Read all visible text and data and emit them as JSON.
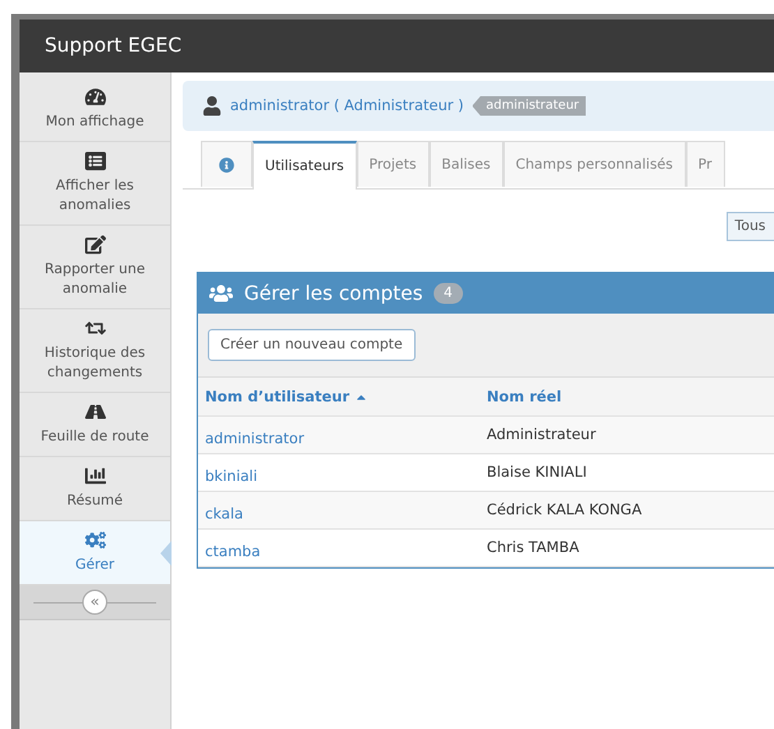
{
  "window": {
    "title": "Support EGEC"
  },
  "sidebar": {
    "items": [
      {
        "label": "Mon affichage",
        "selected": false
      },
      {
        "label": "Afficher les anomalies",
        "selected": false
      },
      {
        "label": "Rapporter une anomalie",
        "selected": false
      },
      {
        "label": "Historique des changements",
        "selected": false
      },
      {
        "label": "Feuille de route",
        "selected": false
      },
      {
        "label": "Résumé",
        "selected": false
      },
      {
        "label": "Gérer",
        "selected": true
      }
    ],
    "collapse_button": "«"
  },
  "breadcrumb": {
    "user": "administrator ( Administrateur )",
    "role": "administrateur"
  },
  "tabs": [
    {
      "kind": "icon",
      "selected": false
    },
    {
      "kind": "text",
      "label": "Utilisateurs",
      "selected": true
    },
    {
      "kind": "text",
      "label": "Projets",
      "selected": false
    },
    {
      "kind": "text",
      "label": "Balises",
      "selected": false
    },
    {
      "kind": "text",
      "label": "Champs personnalisés",
      "selected": false
    },
    {
      "kind": "text",
      "label": "Pr",
      "selected": false
    }
  ],
  "filter_button": "Tous",
  "accounts": {
    "title": "Gérer les comptes",
    "count": "4",
    "create_button": "Créer un nouveau compte",
    "columns": [
      {
        "label": "Nom d’utilisateur",
        "sorted": true
      },
      {
        "label": "Nom réel",
        "sorted": false
      }
    ],
    "rows": [
      {
        "username": "administrator",
        "real_name": "Administrateur"
      },
      {
        "username": "bkiniali",
        "real_name": "Blaise KINIALI"
      },
      {
        "username": "ckala",
        "real_name": "Cédrick KALA KONGA"
      },
      {
        "username": "ctamba",
        "real_name": "Chris TAMBA"
      }
    ]
  }
}
